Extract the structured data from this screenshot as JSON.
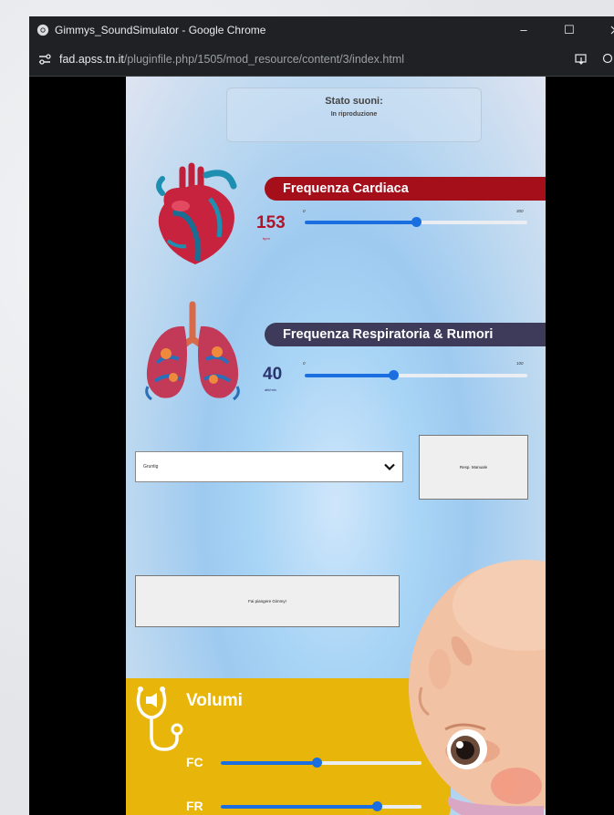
{
  "browser": {
    "title": "Gimmys_SoundSimulator - Google Chrome",
    "url_host": "fad.apss.tn.it",
    "url_path": "/pluginfile.php/1505/mod_resource/content/3/index.html",
    "controls": {
      "minimize": "–",
      "maximize": "☐"
    }
  },
  "status": {
    "label": "Stato suoni:",
    "value": "In riproduzione"
  },
  "heart_rate": {
    "title": "Frequenza Cardiaca",
    "value": "153",
    "unit": "bpm",
    "min": "0",
    "max": "300",
    "slider_fraction": 0.5
  },
  "resp_rate": {
    "title": "Frequenza Respiratoria & Rumori",
    "value": "40",
    "unit": "atti/min",
    "min": "0",
    "max": "100",
    "slider_fraction": 0.4
  },
  "sound_select": {
    "selected": "Gruntig"
  },
  "buttons": {
    "manual_resp": "Resp. Manuale",
    "cry": "Fai piangere Gimmy!"
  },
  "volumes": {
    "title": "Volumi",
    "fc_label": "FC",
    "fr_label": "FR",
    "fc_fraction": 0.48,
    "fr_fraction": 0.78
  },
  "colors": {
    "heart_banner": "#a40f1a",
    "resp_banner": "#3d3a5a",
    "heart_value": "#b0142a",
    "resp_value": "#2a3570",
    "slider": "#1b6ee0",
    "volumes_panel": "#e8b50a"
  }
}
